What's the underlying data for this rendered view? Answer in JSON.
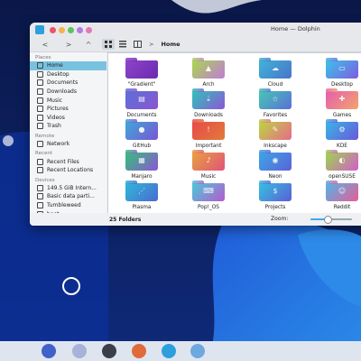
{
  "window": {
    "title": "Home — Dolphin"
  },
  "toolbar": {
    "back": "<",
    "forward": ">",
    "up": "^",
    "view_icons": "grid",
    "view_details": "details",
    "view_split": "split",
    "crumb_sep": ">",
    "crumb": "Home"
  },
  "sidebar": {
    "places_label": "Places",
    "places": [
      {
        "label": "Home",
        "icon": "home-icon",
        "selected": true
      },
      {
        "label": "Desktop",
        "icon": "desktop-icon"
      },
      {
        "label": "Documents",
        "icon": "documents-icon"
      },
      {
        "label": "Downloads",
        "icon": "downloads-icon"
      },
      {
        "label": "Music",
        "icon": "music-icon"
      },
      {
        "label": "Pictures",
        "icon": "pictures-icon"
      },
      {
        "label": "Videos",
        "icon": "videos-icon"
      },
      {
        "label": "Trash",
        "icon": "trash-icon"
      }
    ],
    "remote_label": "Remote",
    "remote": [
      {
        "label": "Network",
        "icon": "network-icon"
      }
    ],
    "recent_label": "Recent",
    "recent": [
      {
        "label": "Recent Files",
        "icon": "recent-files-icon"
      },
      {
        "label": "Recent Locations",
        "icon": "recent-locations-icon"
      }
    ],
    "devices_label": "Devices",
    "devices": [
      {
        "label": "149.5 GiB Intern...",
        "icon": "drive-icon"
      },
      {
        "label": "Basic data parti...",
        "icon": "drive-icon"
      },
      {
        "label": "Tumbleweed",
        "icon": "drive-icon"
      },
      {
        "label": "boot",
        "icon": "drive-icon"
      }
    ]
  },
  "folders": [
    {
      "label": "\"Gradient\"",
      "color1": "#8e44c9",
      "color2": "#6a2bb0",
      "glyph": ""
    },
    {
      "label": "Arch",
      "color1": "#a6d94a",
      "color2": "#c27ad8",
      "glyph": "▲"
    },
    {
      "label": "Cloud",
      "color1": "#3fb4d8",
      "color2": "#4a74c8",
      "glyph": "☁"
    },
    {
      "label": "Desktop",
      "color1": "#3ac3e8",
      "color2": "#7e5de0",
      "glyph": "▭"
    },
    {
      "label": "Documents",
      "color1": "#5b6fd8",
      "color2": "#8c56d0",
      "glyph": "▤"
    },
    {
      "label": "Downloads",
      "color1": "#2fc4b8",
      "color2": "#8e56d6",
      "glyph": "⇣"
    },
    {
      "label": "Favorites",
      "color1": "#46c7b4",
      "color2": "#5b6fd8",
      "glyph": "☆"
    },
    {
      "label": "Games",
      "color1": "#e65db0",
      "color2": "#f2a56a",
      "glyph": "✚"
    },
    {
      "label": "GitHub",
      "color1": "#3ea8d8",
      "color2": "#7b55d4",
      "glyph": "●"
    },
    {
      "label": "Important",
      "color1": "#e84a4a",
      "color2": "#e07a3a",
      "glyph": "!"
    },
    {
      "label": "Inkscape",
      "color1": "#b9d83e",
      "color2": "#e76a8c",
      "glyph": "✎"
    },
    {
      "label": "KDE",
      "color1": "#38b6e8",
      "color2": "#6a58d8",
      "glyph": "⚙"
    },
    {
      "label": "Manjaro",
      "color1": "#33c07a",
      "color2": "#8e56d6",
      "glyph": "▦"
    },
    {
      "label": "Music",
      "color1": "#e8a23e",
      "color2": "#e0537a",
      "glyph": "♪"
    },
    {
      "label": "Neon",
      "color1": "#3aa7e6",
      "color2": "#5c62d8",
      "glyph": "◉"
    },
    {
      "label": "openSUSE",
      "color1": "#9ad84a",
      "color2": "#d45ccc",
      "glyph": "◐"
    },
    {
      "label": "Plasma",
      "color1": "#2fb8d8",
      "color2": "#4a6ad2",
      "glyph": "⋰"
    },
    {
      "label": "Pop!_OS",
      "color1": "#4cc9d6",
      "color2": "#b55ad0",
      "glyph": "⌨"
    },
    {
      "label": "Projects",
      "color1": "#35c2e0",
      "color2": "#5b5ed6",
      "glyph": "$"
    },
    {
      "label": "Reddit",
      "color1": "#52b4e8",
      "color2": "#e65d96",
      "glyph": "☺"
    }
  ],
  "status": {
    "count": "25 Folders",
    "zoom_label": "Zoom:",
    "zoom_level": 0.4
  },
  "colors": {
    "selection": "#78c2e0",
    "accent": "#3daee9",
    "dot_red": "#ed5567",
    "dot_yellow": "#f4b24b",
    "dot_green": "#5ec25e",
    "dot_purple": "#b37be0"
  },
  "taskbar": {
    "items": [
      {
        "name": "launcher-icon",
        "color": "#3f61c9"
      },
      {
        "name": "discover-icon",
        "color": "#a7b2d8"
      },
      {
        "name": "settings-icon",
        "color": "#3a3f4a"
      },
      {
        "name": "firefox-icon",
        "color": "#e06a3a"
      },
      {
        "name": "dolphin-icon",
        "color": "#2d9fdc"
      },
      {
        "name": "system-info-icon",
        "color": "#6fa8e0"
      }
    ]
  }
}
